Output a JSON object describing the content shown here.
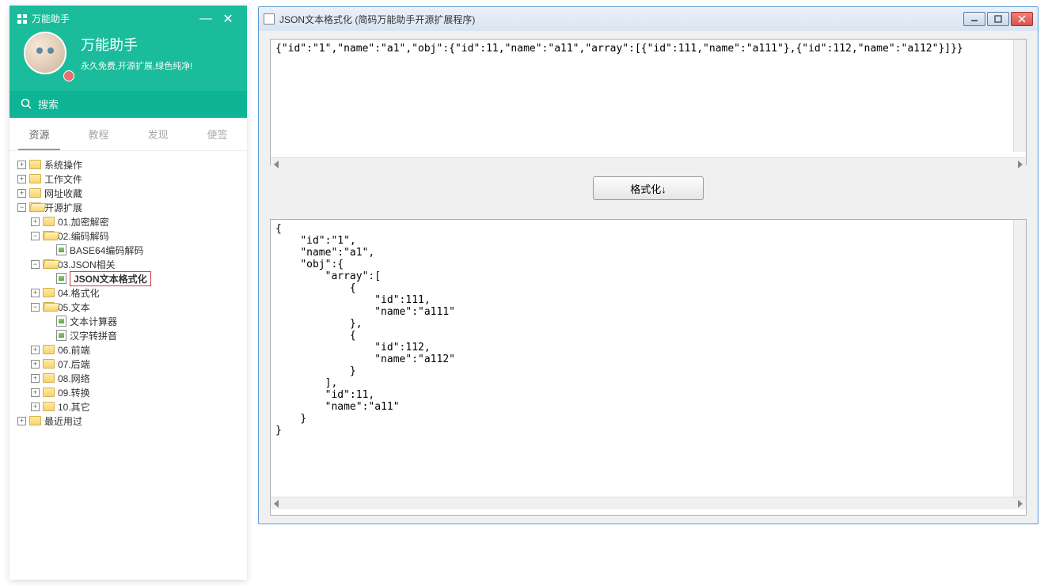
{
  "sidebar": {
    "window_title": "万能助手",
    "profile_title": "万能助手",
    "profile_subtitle": "永久免费,开源扩展,绿色纯净!",
    "search_placeholder": "搜索",
    "tabs": [
      "资源",
      "教程",
      "发现",
      "便签"
    ],
    "tree": [
      {
        "label": "系统操作",
        "level": 0,
        "expanded": false,
        "type": "folder"
      },
      {
        "label": "工作文件",
        "level": 0,
        "expanded": false,
        "type": "folder"
      },
      {
        "label": "网址收藏",
        "level": 0,
        "expanded": false,
        "type": "folder"
      },
      {
        "label": "开源扩展",
        "level": 0,
        "expanded": true,
        "type": "folder"
      },
      {
        "label": "01.加密解密",
        "level": 1,
        "expanded": false,
        "type": "folder"
      },
      {
        "label": "02.编码解码",
        "level": 1,
        "expanded": true,
        "type": "folder"
      },
      {
        "label": "BASE64编码解码",
        "level": 2,
        "expanded": null,
        "type": "file"
      },
      {
        "label": "03.JSON相关",
        "level": 1,
        "expanded": true,
        "type": "folder"
      },
      {
        "label": "JSON文本格式化",
        "level": 2,
        "expanded": null,
        "type": "file",
        "selected": true
      },
      {
        "label": "04.格式化",
        "level": 1,
        "expanded": false,
        "type": "folder"
      },
      {
        "label": "05.文本",
        "level": 1,
        "expanded": true,
        "type": "folder"
      },
      {
        "label": "文本计算器",
        "level": 2,
        "expanded": null,
        "type": "file"
      },
      {
        "label": "汉字转拼音",
        "level": 2,
        "expanded": null,
        "type": "file"
      },
      {
        "label": "06.前端",
        "level": 1,
        "expanded": false,
        "type": "folder"
      },
      {
        "label": "07.后端",
        "level": 1,
        "expanded": false,
        "type": "folder"
      },
      {
        "label": "08.网络",
        "level": 1,
        "expanded": false,
        "type": "folder"
      },
      {
        "label": "09.转换",
        "level": 1,
        "expanded": false,
        "type": "folder"
      },
      {
        "label": "10.其它",
        "level": 1,
        "expanded": false,
        "type": "folder"
      },
      {
        "label": "最近用过",
        "level": 0,
        "expanded": false,
        "type": "folder"
      }
    ]
  },
  "json_window": {
    "title": "JSON文本格式化 (简码万能助手开源扩展程序)",
    "input_text": "{\"id\":\"1\",\"name\":\"a1\",\"obj\":{\"id\":11,\"name\":\"a11\",\"array\":[{\"id\":111,\"name\":\"a111\"},{\"id\":112,\"name\":\"a112\"}]}}",
    "button_label": "格式化↓",
    "output_text": "{\n    \"id\":\"1\",\n    \"name\":\"a1\",\n    \"obj\":{\n        \"array\":[\n            {\n                \"id\":111,\n                \"name\":\"a111\"\n            },\n            {\n                \"id\":112,\n                \"name\":\"a112\"\n            }\n        ],\n        \"id\":11,\n        \"name\":\"a11\"\n    }\n}"
  }
}
